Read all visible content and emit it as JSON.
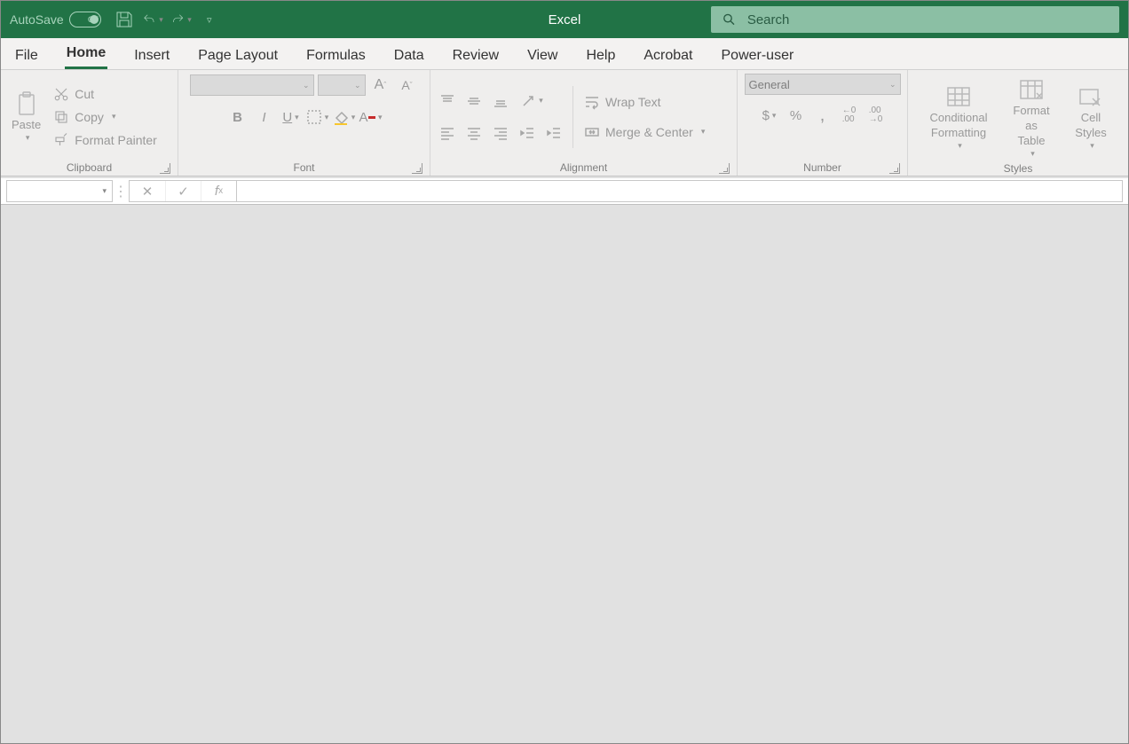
{
  "titlebar": {
    "autosave_label": "AutoSave",
    "autosave_state": "Off",
    "app_title": "Excel",
    "search_placeholder": "Search"
  },
  "tabs": [
    "File",
    "Home",
    "Insert",
    "Page Layout",
    "Formulas",
    "Data",
    "Review",
    "View",
    "Help",
    "Acrobat",
    "Power-user"
  ],
  "active_tab": "Home",
  "ribbon": {
    "clipboard": {
      "label": "Clipboard",
      "paste": "Paste",
      "cut": "Cut",
      "copy": "Copy",
      "format_painter": "Format Painter"
    },
    "font": {
      "label": "Font",
      "font_name": "",
      "font_size": ""
    },
    "alignment": {
      "label": "Alignment",
      "wrap_text": "Wrap Text",
      "merge_center": "Merge & Center"
    },
    "number": {
      "label": "Number",
      "format": "General"
    },
    "styles": {
      "label": "Styles",
      "conditional": "Conditional Formatting",
      "format_table": "Format as Table",
      "cell_styles": "Cell Styles"
    }
  },
  "formula_bar": {
    "name_box": "",
    "formula": ""
  }
}
